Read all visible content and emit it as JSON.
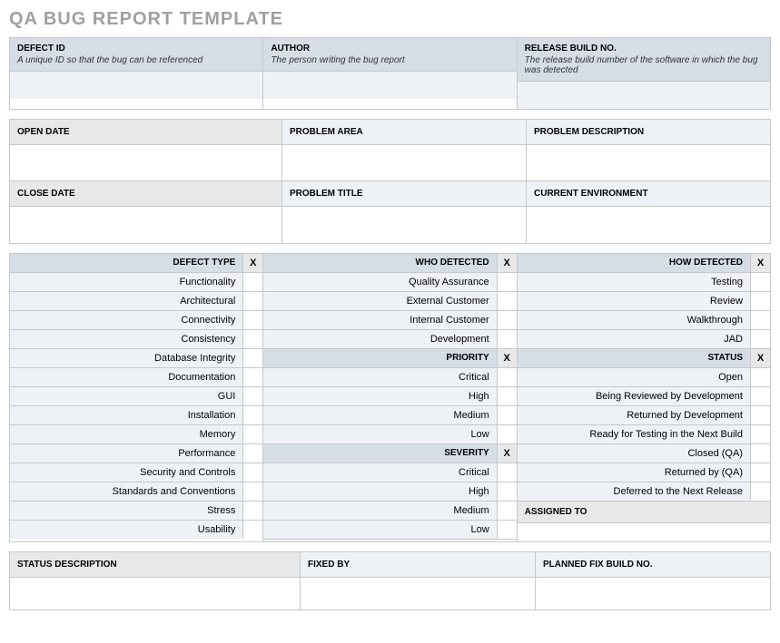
{
  "title": "QA BUG REPORT TEMPLATE",
  "topRow": [
    {
      "label": "DEFECT ID",
      "desc": "A unique ID so that the bug can be referenced"
    },
    {
      "label": "AUTHOR",
      "desc": "The person writing the bug report"
    },
    {
      "label": "RELEASE BUILD NO.",
      "desc": "The release build number of the software in which the bug was detected"
    }
  ],
  "midRow1": [
    "OPEN DATE",
    "PROBLEM AREA",
    "PROBLEM DESCRIPTION"
  ],
  "midRow2": [
    "CLOSE DATE",
    "PROBLEM TITLE",
    "CURRENT ENVIRONMENT"
  ],
  "xMark": "X",
  "col1": {
    "header": "DEFECT TYPE",
    "items": [
      "Functionality",
      "Architectural",
      "Connectivity",
      "Consistency",
      "Database Integrity",
      "Documentation",
      "GUI",
      "Installation",
      "Memory",
      "Performance",
      "Security and Controls",
      "Standards and Conventions",
      "Stress",
      "Usability"
    ]
  },
  "col2": {
    "groups": [
      {
        "header": "WHO DETECTED",
        "items": [
          "Quality Assurance",
          "External Customer",
          "Internal Customer",
          "Development"
        ]
      },
      {
        "header": "PRIORITY",
        "items": [
          "Critical",
          "High",
          "Medium",
          "Low"
        ]
      },
      {
        "header": "SEVERITY",
        "items": [
          "Critical",
          "High",
          "Medium",
          "Low"
        ]
      }
    ]
  },
  "col3": {
    "groups": [
      {
        "header": "HOW DETECTED",
        "items": [
          "Testing",
          "Review",
          "Walkthrough",
          "JAD"
        ]
      },
      {
        "header": "STATUS",
        "items": [
          "Open",
          "Being Reviewed by Development",
          "Returned by Development",
          "Ready for Testing in the Next Build",
          "Closed (QA)",
          "Returned by (QA)",
          "Deferred to the Next Release"
        ]
      }
    ],
    "assigned": "ASSIGNED TO"
  },
  "bottomRow": [
    "STATUS DESCRIPTION",
    "FIXED BY",
    "PLANNED FIX BUILD NO."
  ]
}
